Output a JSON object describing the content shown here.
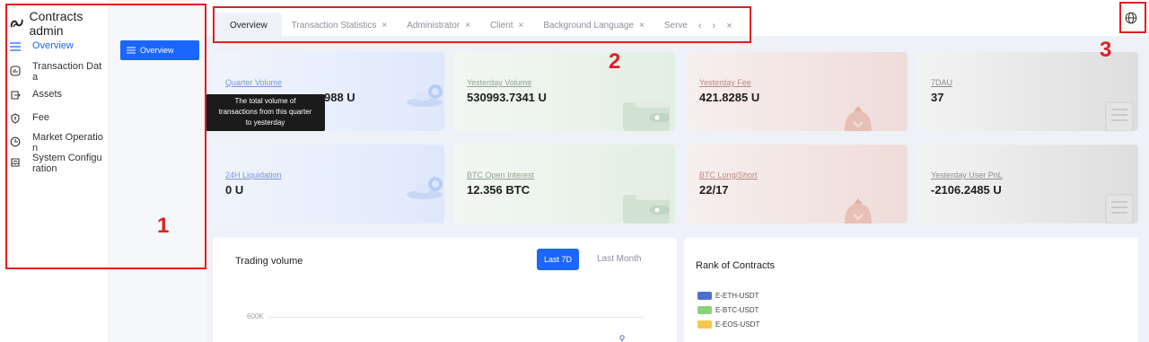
{
  "app": {
    "title": "Contracts admin"
  },
  "sidebar": {
    "items": [
      {
        "label": "Overview",
        "icon": "menu-icon",
        "active": true
      },
      {
        "label": "Transaction Data",
        "icon": "chart-box-icon"
      },
      {
        "label": "Assets",
        "icon": "export-box-icon"
      },
      {
        "label": "Fee",
        "icon": "coin-shield-icon"
      },
      {
        "label": "Market Operation",
        "icon": "clock-pie-icon"
      },
      {
        "label": "System Configuration",
        "icon": "inbox-icon"
      }
    ],
    "sub": {
      "label": "Overview"
    }
  },
  "tabs": {
    "items": [
      {
        "label": "Overview",
        "active": true,
        "closable": false
      },
      {
        "label": "Transaction Statistics",
        "closable": true
      },
      {
        "label": "Administrator",
        "closable": true
      },
      {
        "label": "Client",
        "closable": true
      },
      {
        "label": "Background Language",
        "closable": true
      },
      {
        "label": "Serve",
        "closable": false
      }
    ],
    "close_glyph": "×",
    "prev_glyph": "‹",
    "next_glyph": "›",
    "close_all_glyph": "×"
  },
  "annotations": {
    "one": "1",
    "two": "2",
    "three": "3"
  },
  "cards": [
    {
      "label": "Quarter Volume",
      "value": "988 U",
      "theme": "blue"
    },
    {
      "label": "Yesterday Volume",
      "value": "530993.7341 U",
      "theme": "green"
    },
    {
      "label": "Yesterday Fee",
      "value": "421.8285 U",
      "theme": "red"
    },
    {
      "label": "7DAU",
      "value": "37",
      "theme": "gray"
    },
    {
      "label": "24H Liquidation",
      "value": "0 U",
      "theme": "blue"
    },
    {
      "label": "BTC Open Interest",
      "value": "12.356 BTC",
      "theme": "green"
    },
    {
      "label": "BTC Long/Short",
      "value": "22/17",
      "theme": "red"
    },
    {
      "label": "Yesterday User PnL",
      "value": "-2106.2485 U",
      "theme": "gray"
    }
  ],
  "tooltip": {
    "line1": "The total volume of",
    "line2": "transactions from this quarter",
    "line3": "to yesterday"
  },
  "trading": {
    "title": "Trading volume",
    "btn_7d": "Last 7D",
    "btn_month": "Last Month",
    "y_tick": "600K"
  },
  "rank": {
    "title": "Rank of Contracts",
    "legend": [
      {
        "label": "E-ETH-USDT",
        "color": "#4e6fd0"
      },
      {
        "label": "E-BTC-USDT",
        "color": "#8cd17a"
      },
      {
        "label": "E-EOS-USDT",
        "color": "#f7c64d"
      }
    ]
  },
  "colors": {
    "accent": "#1a66ff",
    "annotation": "#e02020"
  }
}
